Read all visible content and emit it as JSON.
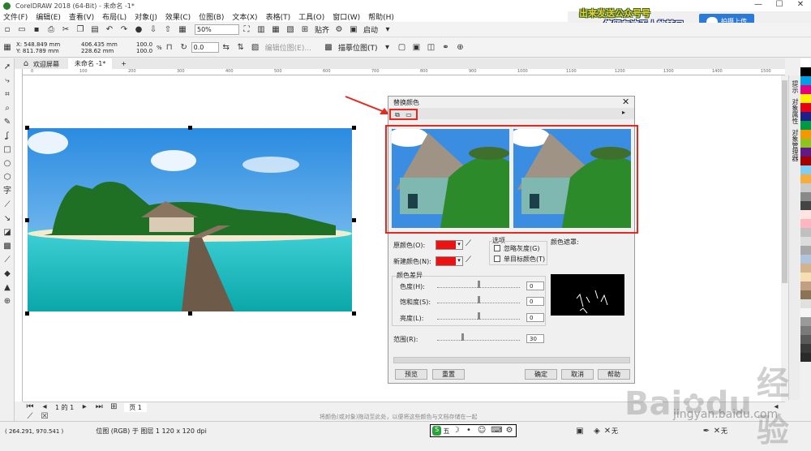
{
  "app": {
    "title": "CorelDRAW 2018 (64-Bit) - 未命名 -1*"
  },
  "window_controls": {
    "minimize": "—",
    "maximize": "☐",
    "close": "✕"
  },
  "menu": [
    "文件(F)",
    "编辑(E)",
    "查看(V)",
    "布局(L)",
    "对象(J)",
    "效果(C)",
    "位图(B)",
    "文本(X)",
    "表格(T)",
    "工具(O)",
    "窗口(W)",
    "帮助(H)"
  ],
  "promo": {
    "line1": "出来发送公众号号",
    "line2": "停留在这无人的转口",
    "upload_label": "拍摄上传"
  },
  "toolbar1": {
    "zoom": "50%",
    "snap_label": "贴齐",
    "launch_label": "启动"
  },
  "toolbar2": {
    "x": "X: 548.849 mm",
    "y": "Y: 811.789 mm",
    "width": "406.435 mm",
    "height": "228.62 mm",
    "scale_w": "100.0",
    "scale_h": "100.0",
    "pct": "%",
    "angle": "0.0",
    "edit_bitmap": "编辑位图(E)...",
    "trace_bitmap": "描摹位图(T)"
  },
  "tabs": {
    "welcome": "欢迎屏幕",
    "doc": "未命名 -1*",
    "add": "+"
  },
  "ruler_ticks": [
    "0",
    "100",
    "200",
    "300",
    "400",
    "500",
    "600",
    "700",
    "800",
    "900",
    "1000",
    "1100",
    "1200",
    "1300",
    "1400",
    "1500"
  ],
  "dialog": {
    "title": "替换颜色",
    "original_color_label": "原颜色(O):",
    "new_color_label": "新建颜色(N):",
    "options_label": "选项",
    "ignore_gray_label": "忽略灰度(G)",
    "single_target_label": "单目标颜色(T)",
    "color_mask_label": "颜色遮罩:",
    "color_diff_label": "颜色差异",
    "hue_label": "色度(H):",
    "hue_value": "0",
    "saturation_label": "饱和度(S):",
    "saturation_value": "0",
    "lightness_label": "亮度(L):",
    "lightness_value": "0",
    "range_label": "范围(R):",
    "range_value": "30",
    "preview_btn": "预览",
    "reset_btn": "重置",
    "ok_btn": "确定",
    "cancel_btn": "取消",
    "help_btn": "帮助",
    "original_color": "#ee1111",
    "new_color": "#ee1111"
  },
  "dockers": [
    "提示",
    "对象属性",
    "对象管理器"
  ],
  "palette": [
    "#ffffff",
    "#000000",
    "#00a0e9",
    "#e4007f",
    "#fff100",
    "#e60012",
    "#1d2088",
    "#009944",
    "#f39800",
    "#8fc31f",
    "#601986",
    "#a40000",
    "#7fcef4",
    "#f6ad3c",
    "#c9caca",
    "#898989",
    "#444444",
    "#ffe4e1",
    "#ffb6c1",
    "#c0c0c0",
    "#dcdcdc",
    "#a9a9a9",
    "#b0c4de",
    "#d2b48c",
    "#f5deb3",
    "#c0a080",
    "#8b7355",
    "#e0e0e0",
    "#f5f5f5",
    "#9a9a9a",
    "#7a7a7a",
    "#5a5a5a",
    "#3a3a3a",
    "#2a2a2a"
  ],
  "pagebar": {
    "page_of": "1 的 1",
    "page_tab": "页 1"
  },
  "status": {
    "coords": "( 264.291, 970.541 )",
    "object_info": "位图 (RGB) 于 图层 1 120 x 120 dpi",
    "hint": "将颜色(或对象)拖动至此处，以便将这些颜色与文档存储在一起",
    "fill_none": "无",
    "outline_none": "无",
    "ime": "五"
  },
  "watermark": {
    "logo": "Bai",
    "logo_paw": "du",
    "text": "经验",
    "url": "jingyan.baidu.com"
  },
  "colors": {
    "accent_red": "#e8281e",
    "arrow": "#e8281e",
    "upload_blue": "#2b79d9"
  }
}
